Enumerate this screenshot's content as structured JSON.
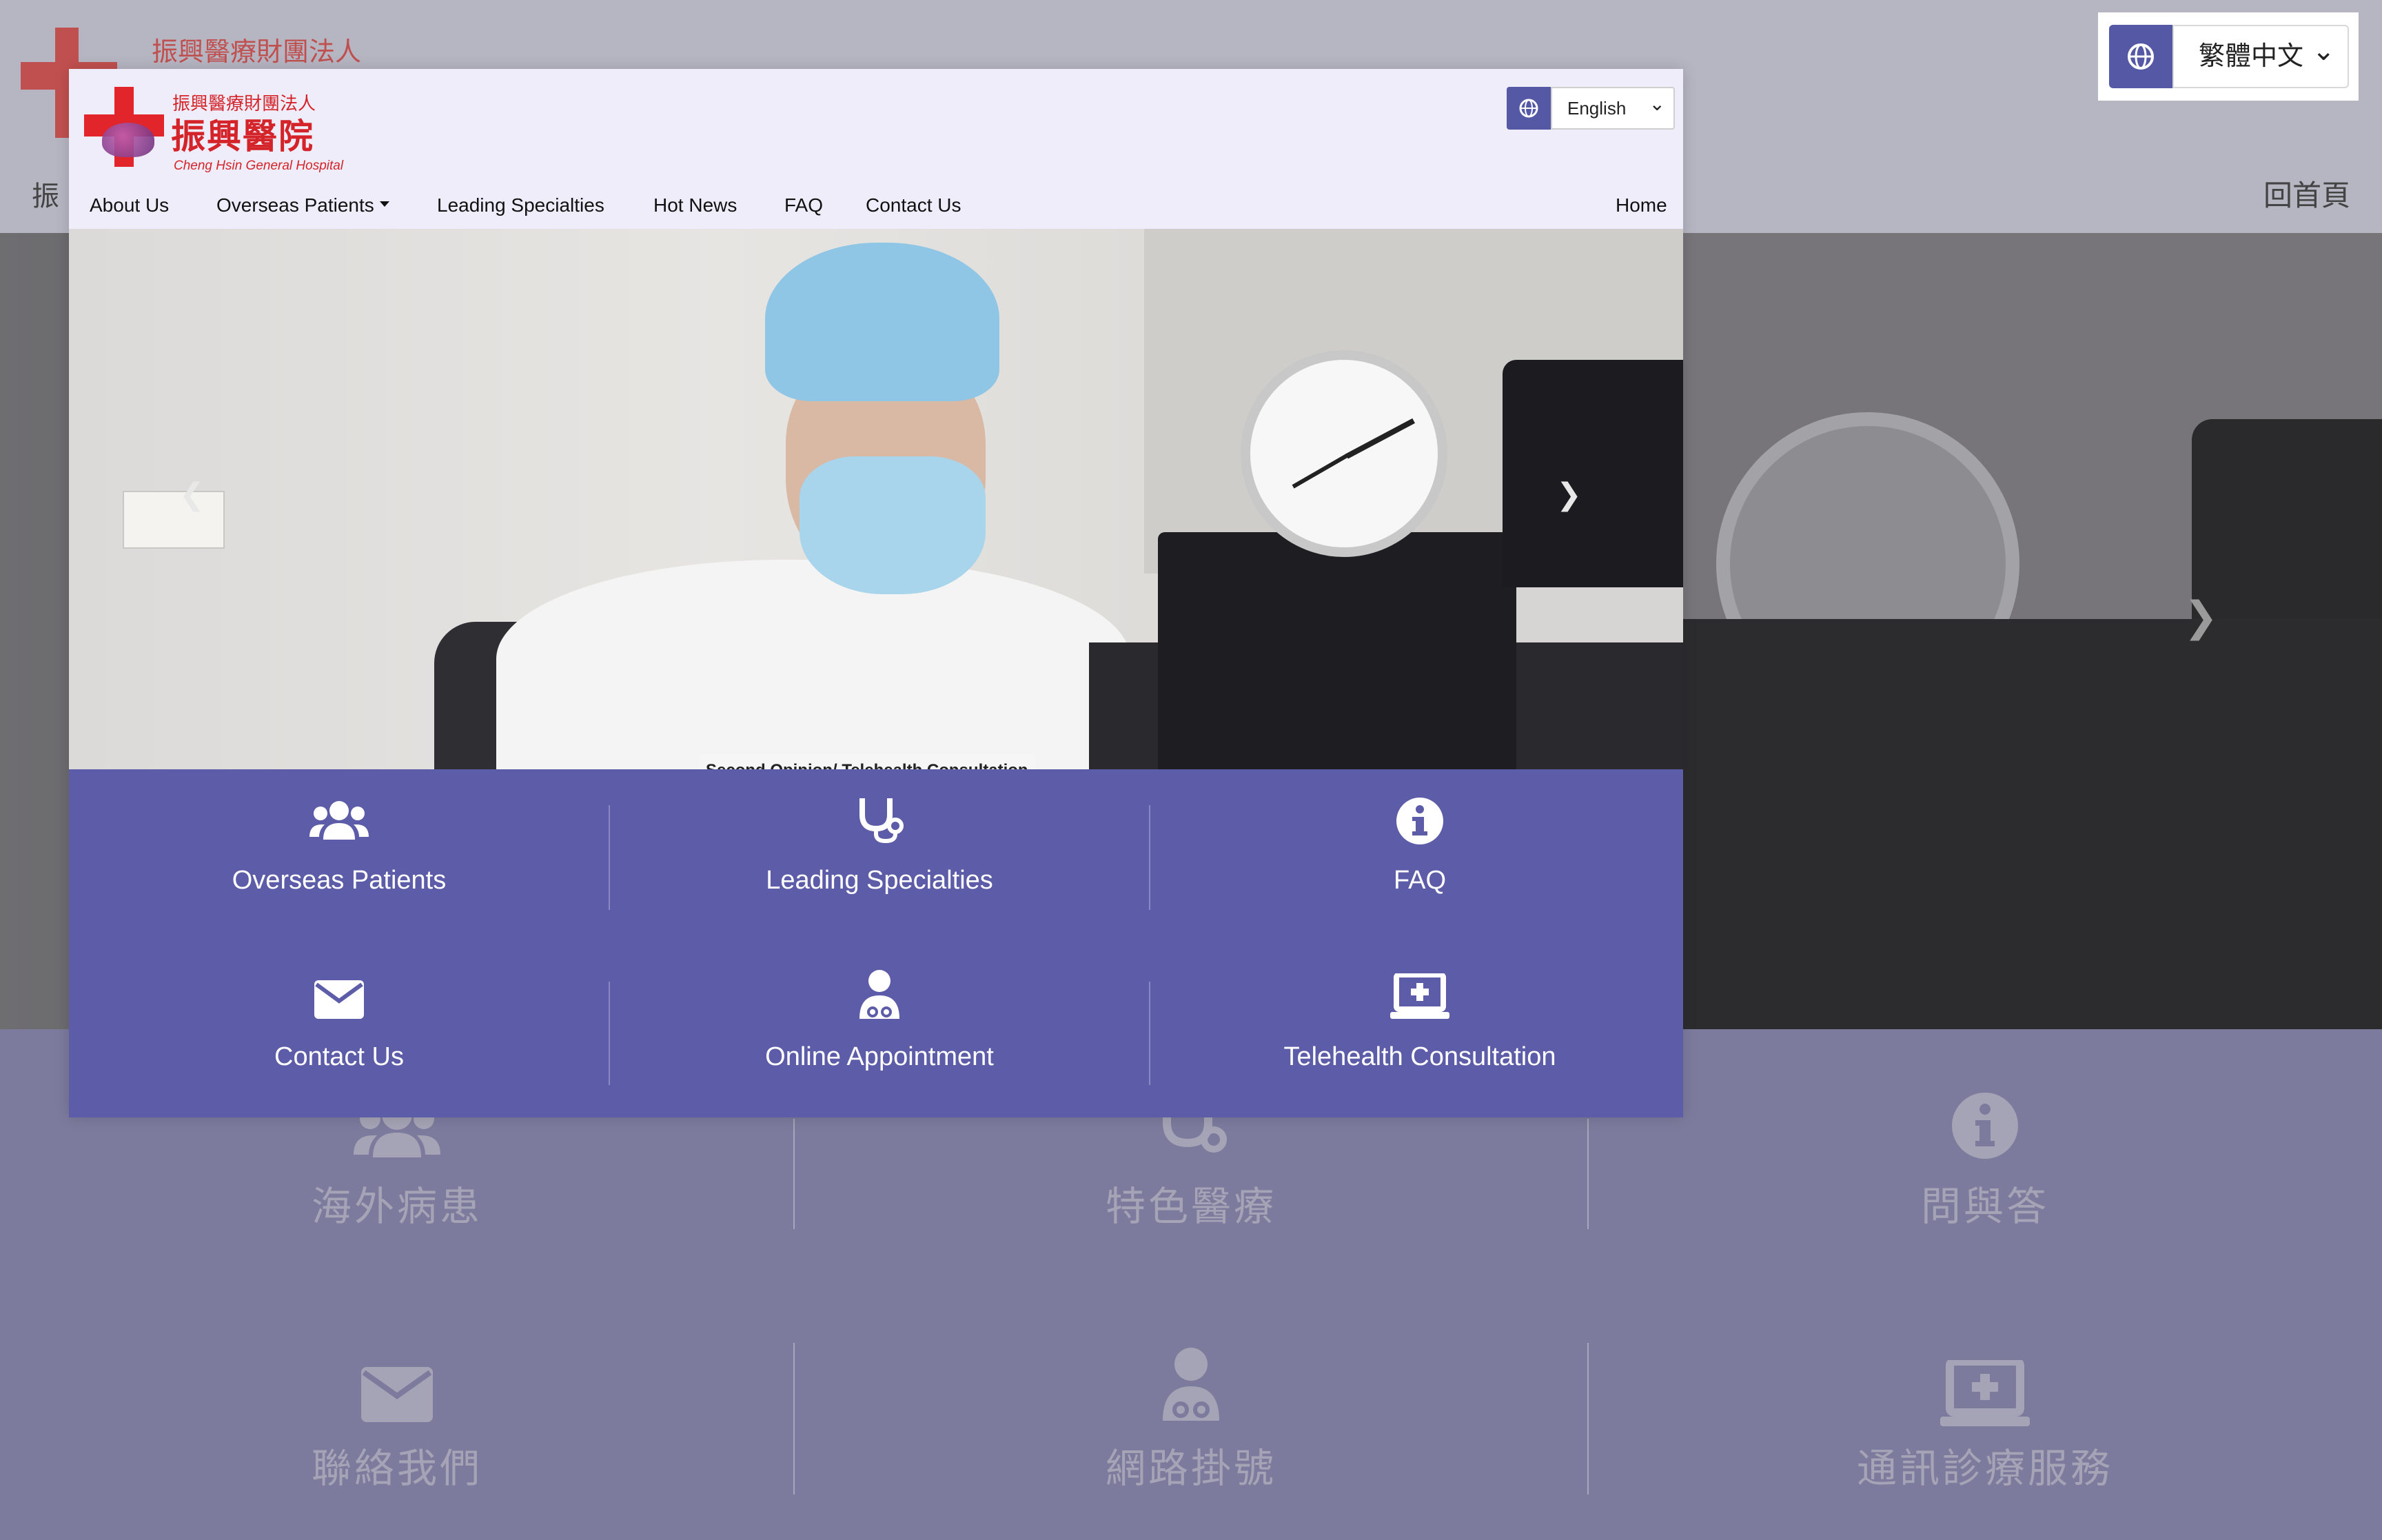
{
  "background_page": {
    "logo": {
      "org_name": "振興醫療財團法人"
    },
    "nav_fragment": "振",
    "home_link": "回首頁",
    "language_select": {
      "selected": "繁體中文"
    },
    "tiles": [
      {
        "label": "海外病患",
        "icon": "users-icon"
      },
      {
        "label": "特色醫療",
        "icon": "stethoscope-icon"
      },
      {
        "label": "問與答",
        "icon": "info-circle-icon"
      },
      {
        "label": "聯絡我們",
        "icon": "envelope-icon"
      },
      {
        "label": "網路掛號",
        "icon": "doctor-icon"
      },
      {
        "label": "通訊診療服務",
        "icon": "laptop-medical-icon"
      }
    ]
  },
  "site": {
    "logo": {
      "org_name": "振興醫療財團法人",
      "hospital_name": "振興醫院",
      "english_name": "Cheng Hsin General Hospital"
    },
    "language_select": {
      "selected": "English"
    },
    "nav": {
      "items": [
        "About Us",
        "Overseas Patients",
        "Leading Specialties",
        "Hot News",
        "FAQ",
        "Contact Us"
      ],
      "home": "Home"
    },
    "carousel": {
      "caption": "Second Opinion/ Telehealth Consultation",
      "slide_count": 10,
      "active_index": 1,
      "prev_icon": "chevron-left-icon",
      "next_icon": "chevron-right-icon"
    },
    "tiles": [
      {
        "label": "Overseas Patients",
        "icon": "users-icon"
      },
      {
        "label": "Leading Specialties",
        "icon": "stethoscope-icon"
      },
      {
        "label": "FAQ",
        "icon": "info-circle-icon"
      },
      {
        "label": "Contact Us",
        "icon": "envelope-icon"
      },
      {
        "label": "Online Appointment",
        "icon": "doctor-icon"
      },
      {
        "label": "Telehealth Consultation",
        "icon": "laptop-medical-icon"
      }
    ]
  },
  "colors": {
    "accent": "#5d5ca8",
    "header_bg": "#efedf9",
    "brand_red": "#d4242a",
    "overlay_bg": "#7c7b9d"
  }
}
